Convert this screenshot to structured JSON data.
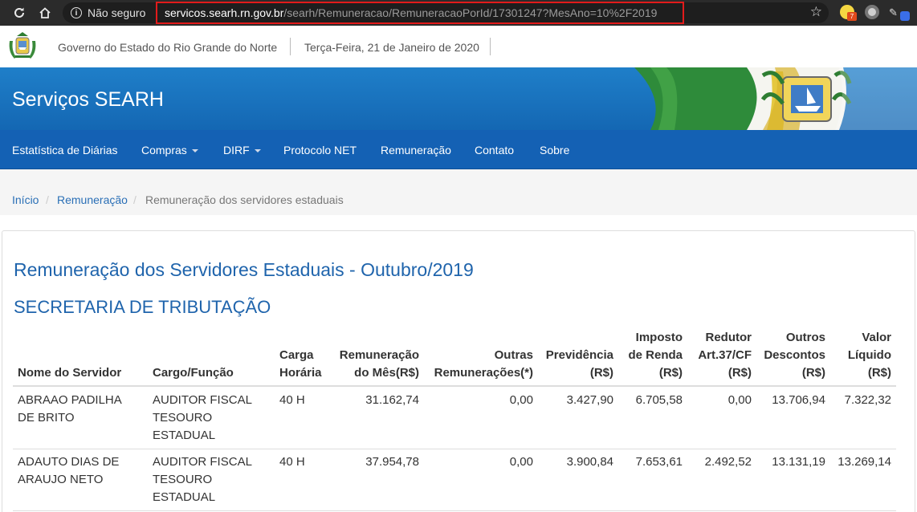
{
  "browser": {
    "security_label": "Não seguro",
    "url_host": "servicos.searh.rn.gov.br",
    "url_path": "/searh/Remuneracao/RemuneracaoPorId/17301247?MesAno=10%2F2019",
    "extension_badge": "7"
  },
  "gov_bar": {
    "name": "Governo do Estado do Rio Grande do Norte",
    "date": "Terça-Feira, 21 de Janeiro de 2020"
  },
  "brand": "Serviços SEARH",
  "nav": [
    {
      "label": "Estatística de Diárias",
      "dropdown": false
    },
    {
      "label": "Compras",
      "dropdown": true
    },
    {
      "label": "DIRF",
      "dropdown": true
    },
    {
      "label": "Protocolo NET",
      "dropdown": false
    },
    {
      "label": "Remuneração",
      "dropdown": false
    },
    {
      "label": "Contato",
      "dropdown": false
    },
    {
      "label": "Sobre",
      "dropdown": false
    }
  ],
  "breadcrumb": {
    "home": "Início",
    "section": "Remuneração",
    "current": "Remuneração dos servidores estaduais",
    "separator": "/"
  },
  "page": {
    "title": "Remuneração dos Servidores Estaduais - Outubro/2019",
    "subtitle": "SECRETARIA DE TRIBUTAÇÃO"
  },
  "table": {
    "headers": {
      "nome": [
        "Nome do Servidor"
      ],
      "cargo": [
        "Cargo/Função"
      ],
      "carga": [
        "Carga",
        "Horária"
      ],
      "remuneracao": [
        "Remuneração",
        "do Mês(R$)"
      ],
      "outras": [
        "Outras",
        "Remunerações(*)"
      ],
      "previdencia": [
        "Previdência",
        "(R$)"
      ],
      "imposto": [
        "Imposto",
        "de Renda",
        "(R$)"
      ],
      "redutor": [
        "Redutor",
        "Art.37/CF",
        "(R$)"
      ],
      "descontos": [
        "Outros",
        "Descontos",
        "(R$)"
      ],
      "liquido": [
        "Valor",
        "Líquido",
        "(R$)"
      ]
    },
    "rows": [
      {
        "nome": [
          "ABRAAO PADILHA",
          "DE BRITO"
        ],
        "cargo": [
          "AUDITOR FISCAL",
          "TESOURO",
          "ESTADUAL"
        ],
        "carga": "40 H",
        "remuneracao": "31.162,74",
        "outras": "0,00",
        "previdencia": "3.427,90",
        "imposto": "6.705,58",
        "redutor": "0,00",
        "descontos": "13.706,94",
        "liquido": "7.322,32"
      },
      {
        "nome": [
          "ADAUTO DIAS DE",
          "ARAUJO NETO"
        ],
        "cargo": [
          "AUDITOR FISCAL",
          "TESOURO",
          "ESTADUAL"
        ],
        "carga": "40 H",
        "remuneracao": "37.954,78",
        "outras": "0,00",
        "previdencia": "3.900,84",
        "imposto": "7.653,61",
        "redutor": "2.492,52",
        "descontos": "13.131,19",
        "liquido": "13.269,14"
      }
    ]
  },
  "colors": {
    "banner": "#1a74c0",
    "navbar": "#1461b4",
    "heading": "#1f64ac",
    "link": "#2a6fb6",
    "url_highlight": "#e21b1b"
  }
}
